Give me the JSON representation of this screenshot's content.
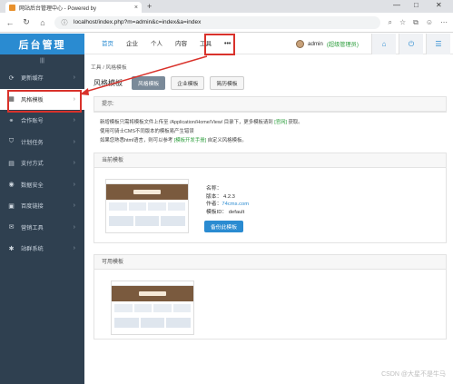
{
  "browser": {
    "tab_title": "网站后台管理中心 - Powered by",
    "url": "localhost/index.php?m=admin&c=index&a=index"
  },
  "brand": "后台管理",
  "sidebar": {
    "collapse_glyph": "|||",
    "items": [
      {
        "label": "更新缓存",
        "icon": "refresh"
      },
      {
        "label": "风格模板",
        "icon": "palette"
      },
      {
        "label": "合作账号",
        "icon": "link"
      },
      {
        "label": "计划任务",
        "icon": "shield"
      },
      {
        "label": "支付方式",
        "icon": "card"
      },
      {
        "label": "数据安全",
        "icon": "database"
      },
      {
        "label": "百度链接",
        "icon": "bookmark"
      },
      {
        "label": "营销工具",
        "icon": "tool"
      },
      {
        "label": "站群系统",
        "icon": "cluster"
      }
    ],
    "active_index": 1
  },
  "topnav": {
    "items": [
      "首页",
      "企业",
      "个人",
      "内容",
      "工具"
    ],
    "more": "•••",
    "active_index": 0,
    "user_name": "admin",
    "user_role": "(超级管理员)"
  },
  "breadcrumb": "工具 / 风格模板",
  "page": {
    "title": "风格模板",
    "tabs": [
      "风格模板",
      "企业模板",
      "简历模板"
    ],
    "active_tab": 0
  },
  "tips": {
    "head": "提示:",
    "line1_a": "新增模板只需将模板文件上传至 /Application/Home/View/ 目录下，更多模板请到",
    "line1_link": "[官网]",
    "line1_b": "获取。",
    "line2": "使用可骑士CMS不同版本的模板易产生错误",
    "line3_a": "如果您熟悉html语言，则可以参考",
    "line3_link": "[模板开发手册]",
    "line3_b": "自定义风格模板。"
  },
  "current_template": {
    "head": "当前模板",
    "name_label": "名称：",
    "version": "版本： 4.2.3",
    "author_label": "作者：",
    "author": "74cms.com",
    "template_id": "模板ID： default",
    "backup_button": "备份此模板"
  },
  "available": {
    "head": "可用模板"
  },
  "watermark": "CSDN @大星不是牛马",
  "colors": {
    "accent": "#2a8bd1",
    "sidebar_bg": "#2f4050",
    "highlight": "#d9322b"
  }
}
